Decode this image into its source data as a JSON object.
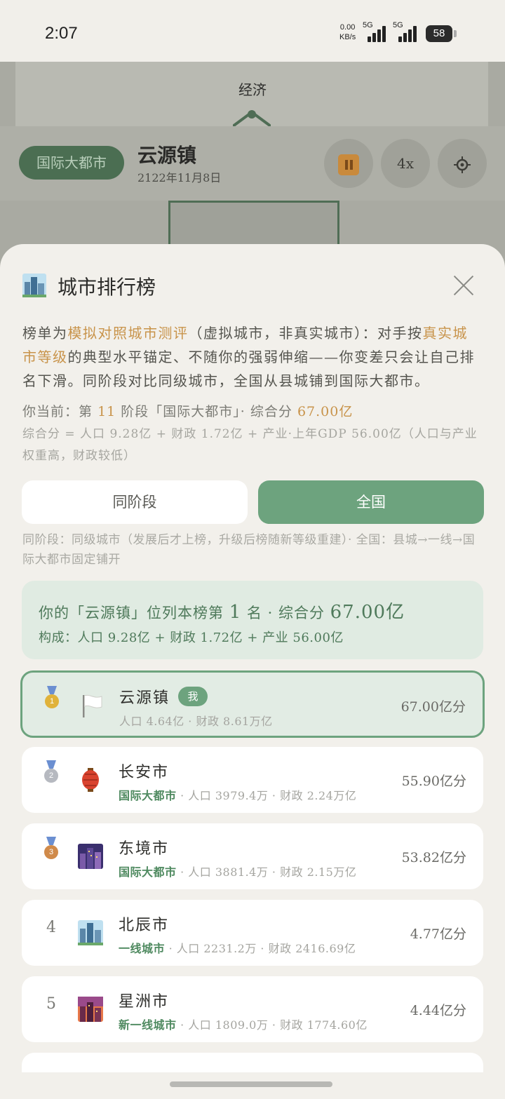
{
  "status_bar": {
    "time": "2:07",
    "net_speed": "0.00",
    "net_unit": "KB/s",
    "sim1": "5G",
    "sim2": "5G",
    "battery": "58"
  },
  "game": {
    "panel_title": "经济",
    "rank_badge": "国际大都市",
    "city_name": "云源镇",
    "date": "2122年11月8日",
    "speed_label": "4x"
  },
  "sheet": {
    "title": "城市排行榜",
    "desc": {
      "p1": "榜单为",
      "h1": "模拟对照城市测评",
      "p2": "（虚拟城市，非真实城市）：对手按",
      "h2": "真实城市等级",
      "p3": "的典型水平锚定、不随你的强弱伸缩——你变差只会让自己排名下滑。同阶段对比同级城市，全国从县城铺到国际大都市。"
    },
    "current": {
      "prefix": "你当前：第",
      "stage": "11",
      "middle": "阶段「国际大都市」· 综合分",
      "score": "67.00亿"
    },
    "formula": "综合分 = 人口 9.28亿 + 财政 1.72亿 + 产业·上年GDP 56.00亿（人口与产业权重高，财政较低）",
    "tabs": {
      "same_stage": "同阶段",
      "national": "全国"
    },
    "tab_note": "同阶段：同级城市（发展后才上榜，升级后榜随新等级重建）· 全国：县城→一线→国际大都市固定铺开",
    "summary": {
      "line1_a": "你的「云源镇」位列本榜第",
      "rank": "1",
      "line1_b": "名 · 综合分",
      "score": "67.00亿",
      "line2": "构成：人口 9.28亿 + 财政 1.72亿 + 产业 56.00亿"
    },
    "me_tag": "我",
    "rows": [
      {
        "rank": "1",
        "medal": "gold-medal",
        "icon": "white-flag-icon",
        "name": "云源镇",
        "level": "",
        "detail": "人口 4.64亿 · 财政 8.61万亿",
        "score": "67.00亿分",
        "is_me": true
      },
      {
        "rank": "2",
        "medal": "silver-medal",
        "icon": "red-lantern-icon",
        "name": "长安市",
        "level": "国际大都市",
        "detail": " · 人口 3979.4万 · 财政 2.24万亿",
        "score": "55.90亿分"
      },
      {
        "rank": "3",
        "medal": "bronze-medal",
        "icon": "night-city-icon",
        "name": "东境市",
        "level": "国际大都市",
        "detail": " · 人口 3881.4万 · 财政 2.15万亿",
        "score": "53.82亿分"
      },
      {
        "rank": "4",
        "icon": "cityscape-icon",
        "name": "北辰市",
        "level": "一线城市",
        "detail": " · 人口 2231.2万 · 财政 2416.69亿",
        "score": "4.77亿分"
      },
      {
        "rank": "5",
        "icon": "sunset-city-icon",
        "name": "星洲市",
        "level": "新一线城市",
        "detail": " · 人口 1809.0万 · 财政 1774.60亿",
        "score": "4.44亿分"
      }
    ]
  }
}
